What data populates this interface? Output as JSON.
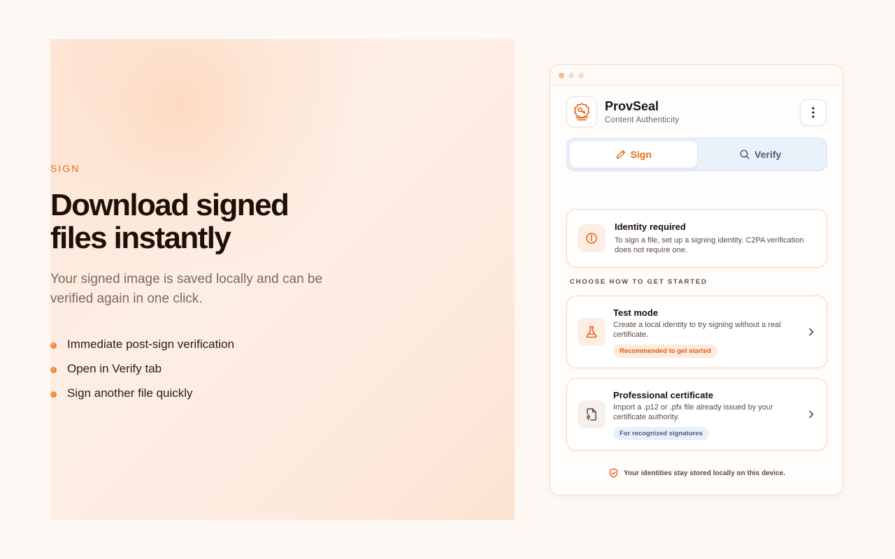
{
  "hero": {
    "eyebrow": "SIGN",
    "headline": "Download signed files instantly",
    "subtext": "Your signed image is saved locally and can be verified again in one click.",
    "bullets": [
      "Immediate post-sign verification",
      "Open in Verify tab",
      "Sign another file quickly"
    ]
  },
  "app": {
    "name": "ProvSeal",
    "subtitle": "Content Authenticity",
    "tabs": [
      {
        "label": "Sign",
        "icon": "pencil-icon",
        "active": true
      },
      {
        "label": "Verify",
        "icon": "search-icon",
        "active": false
      }
    ],
    "notice": {
      "title": "Identity required",
      "body": "To sign a file, set up a signing identity. C2PA verification does not require one."
    },
    "section_label": "CHOOSE HOW TO GET STARTED",
    "options": [
      {
        "title": "Test mode",
        "description": "Create a local identity to try signing without a real certificate.",
        "badge": "Recommended to get started",
        "icon": "flask-icon"
      },
      {
        "title": "Professional certificate",
        "description": "Import a .p12 or .pfx file already issued by your certificate authority.",
        "badge": "For recognized signatures",
        "icon": "certificate-file-icon"
      }
    ],
    "footer": "Your identities stay stored locally on this device."
  },
  "colors": {
    "accent": "#ea6a17",
    "background": "#fef8f4",
    "tab_track": "#e9f1fb"
  }
}
